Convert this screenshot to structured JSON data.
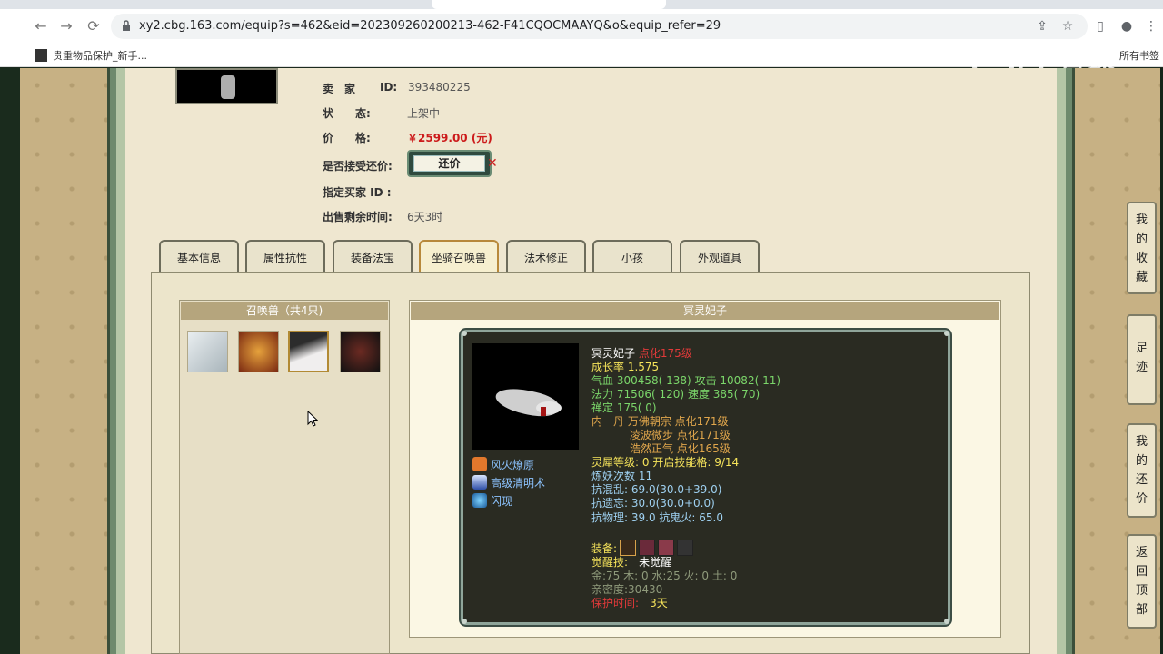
{
  "browser": {
    "url": "xy2.cbg.163.com/equip?s=462&eid=202309260200213-462-F41CQOCMAAYQ&o&equip_refer=29",
    "bookmark": "贵重物品保护_新手...",
    "bookmarks_right": "所有书签",
    "watermark": "CC直播"
  },
  "seller": {
    "seller_label": "卖　家",
    "seller_id_label": "ID:",
    "seller_id": "393480225",
    "status_label": "状　　态:",
    "status_value": "上架中",
    "price_label": "价　　格:",
    "price_value": "￥2599.00 (元)",
    "haggle_label": "是否接受还价:",
    "haggle_button": "还价",
    "buyer_label": "指定买家 ID :",
    "remaining_label": "出售剩余时间:",
    "remaining_value": "6天3时"
  },
  "tabs": [
    "基本信息",
    "属性抗性",
    "装备法宝",
    "坐骑召唤兽",
    "法术修正",
    "小孩",
    "外观道具"
  ],
  "pets": {
    "header": "召唤兽（共4只)"
  },
  "detail": {
    "header": "冥灵妃子",
    "name": "冥灵妃子",
    "level": "点化175级",
    "growth": "成长率 1.575",
    "hp_label": "气血",
    "hp": "300458( 138)",
    "atk_label": "攻击",
    "atk": "10082( 11)",
    "mp_label": "法力",
    "mp": "71506( 120)",
    "spd_label": "速度",
    "spd": "385( 70)",
    "zen": "禅定 175( 0)",
    "neidan_label": "内　丹",
    "neidan1": "万佛朝宗 点化171级",
    "neidan2": "凌波微步 点化171级",
    "neidan3": "浩然正气 点化165级",
    "lingxi_label": "灵犀等级:",
    "lingxi": "0 开启技能格:",
    "lingxi_slots": "9/14",
    "refine": "炼妖次数 11",
    "res1": "抗混乱: 69.0(30.0+39.0)",
    "res2": "抗遗忘: 30.0(30.0+0.0)",
    "res3": "抗物理: 39.0 抗鬼火: 65.0",
    "equip_label": "装备:",
    "awaken_label": "觉醒技:",
    "awaken_value": "未觉醒",
    "elements": "金:75 木: 0 水:25 火: 0 土: 0",
    "intimacy": "亲密度:30430",
    "protect_label": "保护时间:",
    "protect_value": "3天",
    "skills": [
      "风火燎原",
      "高级清明术",
      "闪现"
    ]
  },
  "sidebar": {
    "favorites": [
      "我",
      "的",
      "收",
      "藏"
    ],
    "footprints": [
      "足",
      "迹"
    ],
    "my_haggle": [
      "我",
      "的",
      "还",
      "价"
    ],
    "back_top": [
      "返",
      "回",
      "顶",
      "部"
    ]
  }
}
